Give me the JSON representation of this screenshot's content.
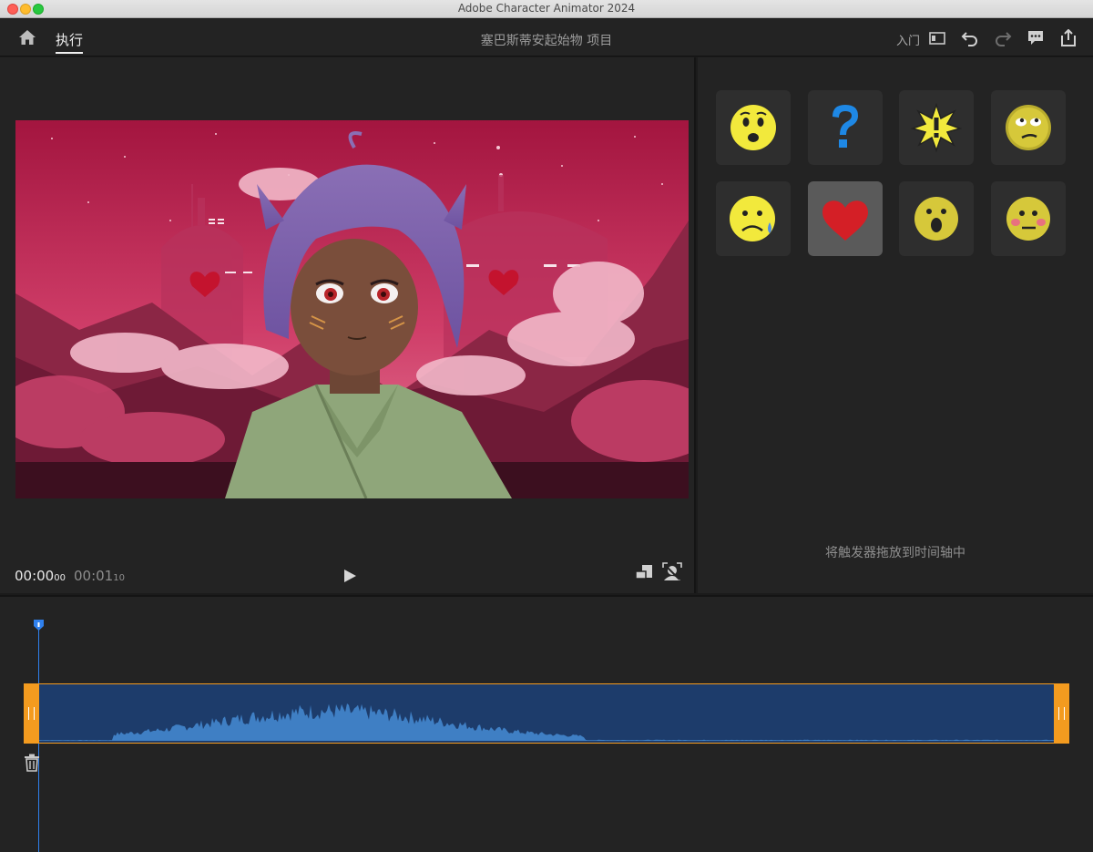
{
  "window": {
    "title": "Adobe Character Animator 2024"
  },
  "header": {
    "tab_label": "执行",
    "project_title": "塞巴斯蒂安起始物 项目",
    "getting_started_label": "入门"
  },
  "stage": {
    "current_time": "00:00",
    "current_frames": "00",
    "duration_time": "00:01",
    "duration_frames": "10"
  },
  "triggers": {
    "items": [
      {
        "icon": "worried-face-icon"
      },
      {
        "icon": "question-mark-icon"
      },
      {
        "icon": "exclamation-burst-icon"
      },
      {
        "icon": "eye-roll-face-icon"
      },
      {
        "icon": "sad-tear-face-icon"
      },
      {
        "icon": "heart-icon",
        "selected": true
      },
      {
        "icon": "surprised-face-icon"
      },
      {
        "icon": "blushing-face-icon"
      }
    ],
    "drop_hint": "将触发器拖放到时间轴中"
  },
  "colors": {
    "accent_orange": "#f39b1f",
    "playhead_blue": "#2f80ed",
    "clip_fill": "#1d3c6b",
    "emoji_yellow": "#f2e93c"
  }
}
